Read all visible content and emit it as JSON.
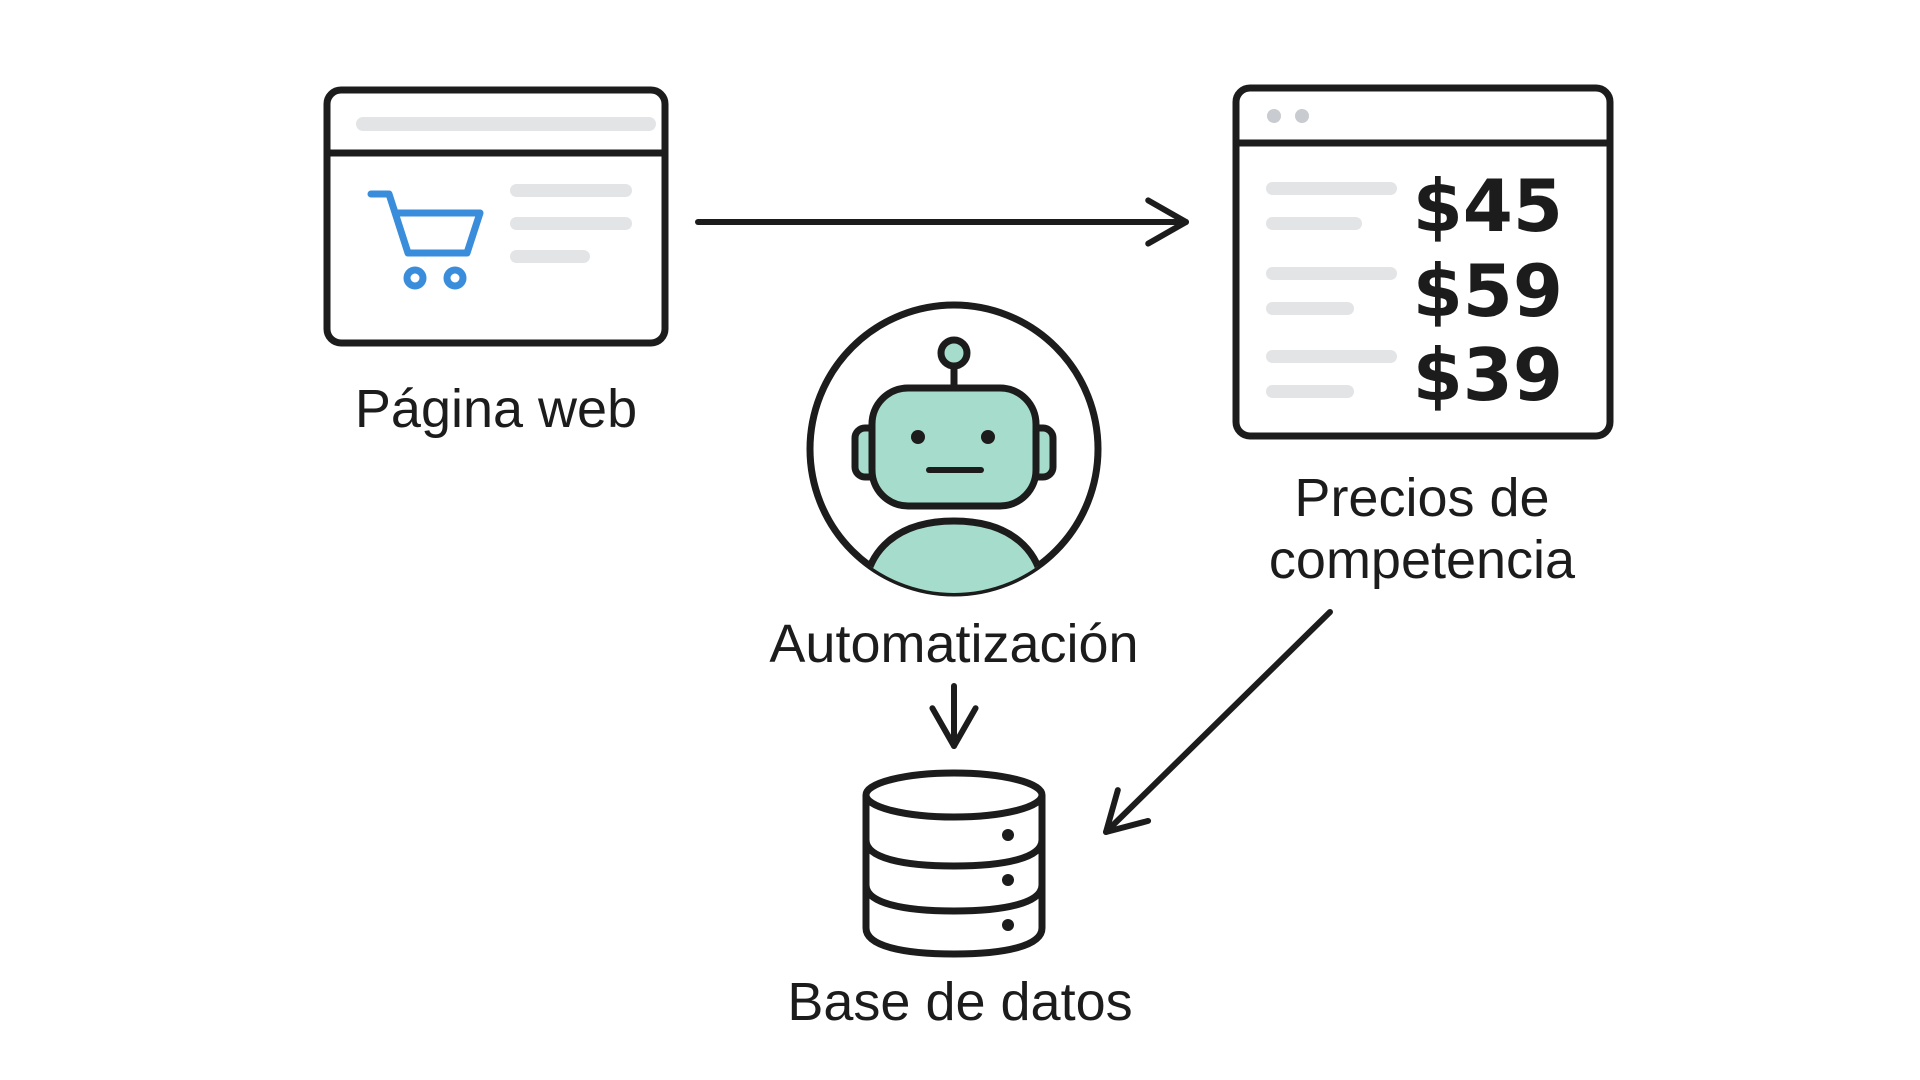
{
  "nodes": {
    "web_page": {
      "label": "Página web",
      "icon": "shopping-cart-icon"
    },
    "competitor_prices": {
      "label_line1": "Precios de",
      "label_line2": "competencia",
      "prices": [
        "$45",
        "$59",
        "$39"
      ]
    },
    "automation": {
      "label": "Automatización",
      "icon": "robot-icon"
    },
    "database": {
      "label": "Base de datos",
      "icon": "database-icon"
    }
  },
  "colors": {
    "stroke": "#1c1c1c",
    "cart": "#3a8ddb",
    "robot": "#a6dccb",
    "placeholder": "#e2e4e6",
    "dots": "#c8cbcf"
  }
}
